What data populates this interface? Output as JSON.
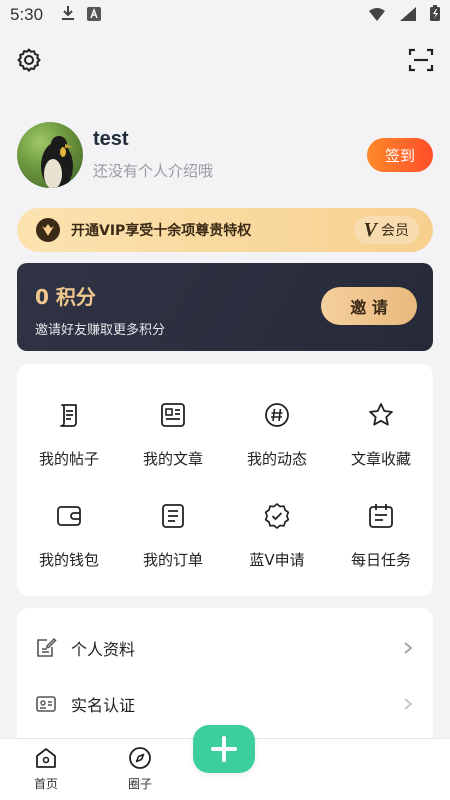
{
  "status_bar": {
    "time": "5:30",
    "icons": [
      "download-icon",
      "text-a-icon",
      "wifi-icon",
      "signal-icon",
      "battery-icon"
    ]
  },
  "header": {
    "icons": [
      "settings-gear-icon",
      "scan-icon"
    ]
  },
  "profile": {
    "username": "test",
    "bio": "还没有个人介绍哦",
    "signin_label": "签到"
  },
  "vip_banner": {
    "text": "开通VIP享受十余项尊贵特权",
    "tag_letter": "V",
    "tag_label": "会员",
    "icon": "vip-crown-icon"
  },
  "points_card": {
    "points_text": "0 积分",
    "description": "邀请好友赚取更多积分",
    "invite_label": "邀 请"
  },
  "menu_grid": [
    {
      "label": "我的帖子",
      "icon": "scroll-icon"
    },
    {
      "label": "我的文章",
      "icon": "article-icon"
    },
    {
      "label": "我的动态",
      "icon": "hashtag-icon"
    },
    {
      "label": "文章收藏",
      "icon": "star-icon"
    },
    {
      "label": "我的钱包",
      "icon": "wallet-icon"
    },
    {
      "label": "我的订单",
      "icon": "order-list-icon"
    },
    {
      "label": "蓝V申请",
      "icon": "verified-badge-icon"
    },
    {
      "label": "每日任务",
      "icon": "calendar-icon"
    }
  ],
  "settings_list": [
    {
      "label": "个人资料",
      "icon": "edit-document-icon"
    },
    {
      "label": "实名认证",
      "icon": "id-card-icon"
    }
  ],
  "bottom_nav": {
    "items": [
      {
        "label": "首页",
        "icon": "home-icon"
      },
      {
        "label": "圈子",
        "icon": "compass-icon"
      }
    ],
    "fab_icon": "plus-icon"
  },
  "colors": {
    "accent_green": "#3ccf9d",
    "signin_orange": "#ff6a2a",
    "vip_gold": "#f7d08f",
    "points_dark": "#2b2f3e",
    "points_gold": "#f1c88e"
  }
}
